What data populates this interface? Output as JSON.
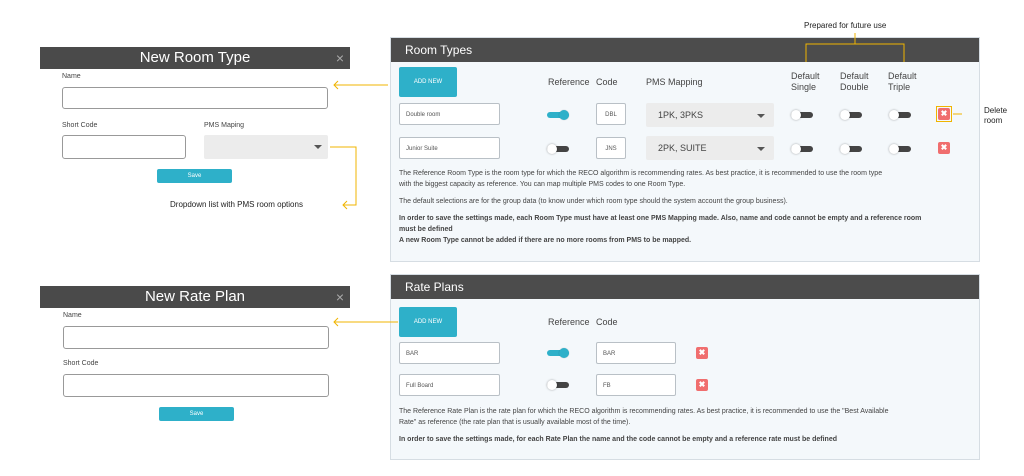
{
  "room_modal": {
    "title": "New Room Type",
    "close": "×",
    "name_label": "Name",
    "short_code_label": "Short Code",
    "pms_label": "PMS Maping",
    "save": "Save"
  },
  "rate_modal": {
    "title": "New Rate Plan",
    "close": "×",
    "name_label": "Name",
    "short_code_label": "Short Code",
    "save": "Save"
  },
  "room_types": {
    "title": "Room Types",
    "add_new": "ADD NEW",
    "headers": {
      "reference": "Reference",
      "code": "Code",
      "pms": "PMS Mapping",
      "default_single_1": "Default",
      "default_single_2": "Single",
      "default_double_1": "Default",
      "default_double_2": "Double",
      "default_triple_1": "Default",
      "default_triple_2": "Triple"
    },
    "rows": [
      {
        "name": "Double room",
        "code": "DBL",
        "pms": "1PK, 3PKS",
        "reference": true,
        "single": false,
        "double": false,
        "triple": false
      },
      {
        "name": "Junior Suite",
        "code": "JNS",
        "pms": "2PK, SUITE",
        "reference": false,
        "single": false,
        "double": false,
        "triple": false
      }
    ],
    "delete_glyph": "✖",
    "info_1a": "The Reference Room Type is the room type for which the RECO algorithm is recommending rates. As best practice, it is recommended to use the room type",
    "info_1b": "with the biggest capacity as reference. You can map multiple PMS codes to one Room Type.",
    "info_2": "The default selections are for the group data (to know under which room type should the system account the group business).",
    "info_3a": "In order to save the settings made, each Room Type must have at least one PMS Mapping made. Also, name and code cannot be empty and a reference room",
    "info_3b": "must be defined",
    "info_4": "A new Room Type cannot be added if there are no more rooms from PMS to be mapped."
  },
  "rate_plans": {
    "title": "Rate Plans",
    "add_new": "ADD NEW",
    "headers": {
      "reference": "Reference",
      "code": "Code"
    },
    "rows": [
      {
        "name": "BAR",
        "code": "BAR",
        "reference": true
      },
      {
        "name": "Full Board",
        "code": "FB",
        "reference": false
      }
    ],
    "delete_glyph": "✖",
    "info_1a": "The Reference Rate Plan is the rate plan for which the RECO algorithm is recommending rates. As best practice, it is recommended to use the \"Best Available",
    "info_1b": "Rate\" as reference (the rate plan that is usually available most of the time).",
    "info_2": "In order to save the settings made, for each Rate Plan the name and the code cannot be empty and a reference rate must be defined"
  },
  "annotations": {
    "future_use": "Prepared for future use",
    "delete_room_1": "Delete",
    "delete_room_2": "room",
    "dropdown_note": "Dropdown list with PMS room options"
  },
  "colors": {
    "accent": "#2eb0c9",
    "header": "#4c4c4c",
    "delete": "#f06e6e",
    "annotation": "#f0b400"
  }
}
